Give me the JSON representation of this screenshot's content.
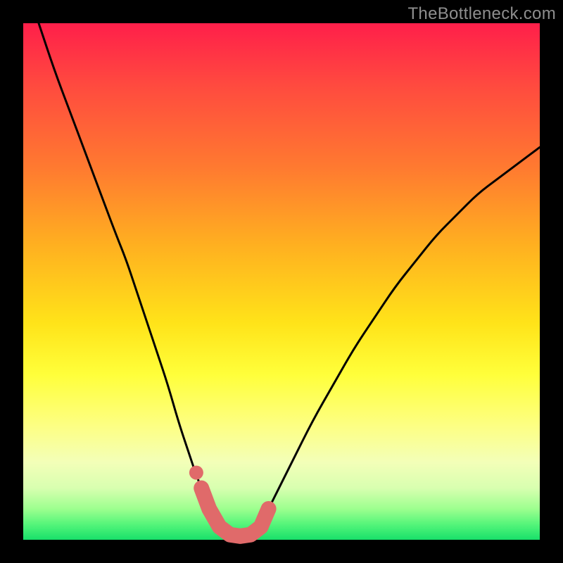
{
  "watermark": "TheBottleneck.com",
  "chart_data": {
    "type": "line",
    "title": "",
    "xlabel": "",
    "ylabel": "",
    "xlim": [
      0,
      100
    ],
    "ylim": [
      0,
      100
    ],
    "series": [
      {
        "name": "bottleneck-curve",
        "x": [
          3,
          6,
          9,
          12,
          15,
          18,
          20,
          22,
          24,
          26,
          28,
          30,
          32,
          34,
          36,
          38,
          40,
          42,
          44,
          46,
          48,
          52,
          56,
          60,
          64,
          68,
          72,
          76,
          80,
          84,
          88,
          92,
          96,
          100
        ],
        "values": [
          100,
          91,
          83,
          75,
          67,
          59,
          54,
          48,
          42,
          36,
          30,
          23,
          17,
          11,
          7,
          3,
          1,
          0.5,
          1,
          3,
          7,
          15,
          23,
          30,
          37,
          43,
          49,
          54,
          59,
          63,
          67,
          70,
          73,
          76
        ]
      }
    ],
    "trough_markers": {
      "name": "trough-highlight",
      "color": "#e06a6a",
      "x": [
        34.5,
        36,
        38,
        40,
        42,
        44,
        46,
        47.5
      ],
      "values": [
        10,
        6,
        2.5,
        1,
        0.7,
        1,
        2.5,
        6
      ]
    }
  },
  "colors": {
    "curve": "#000000",
    "marker": "#e06a6a",
    "frame": "#000000"
  }
}
